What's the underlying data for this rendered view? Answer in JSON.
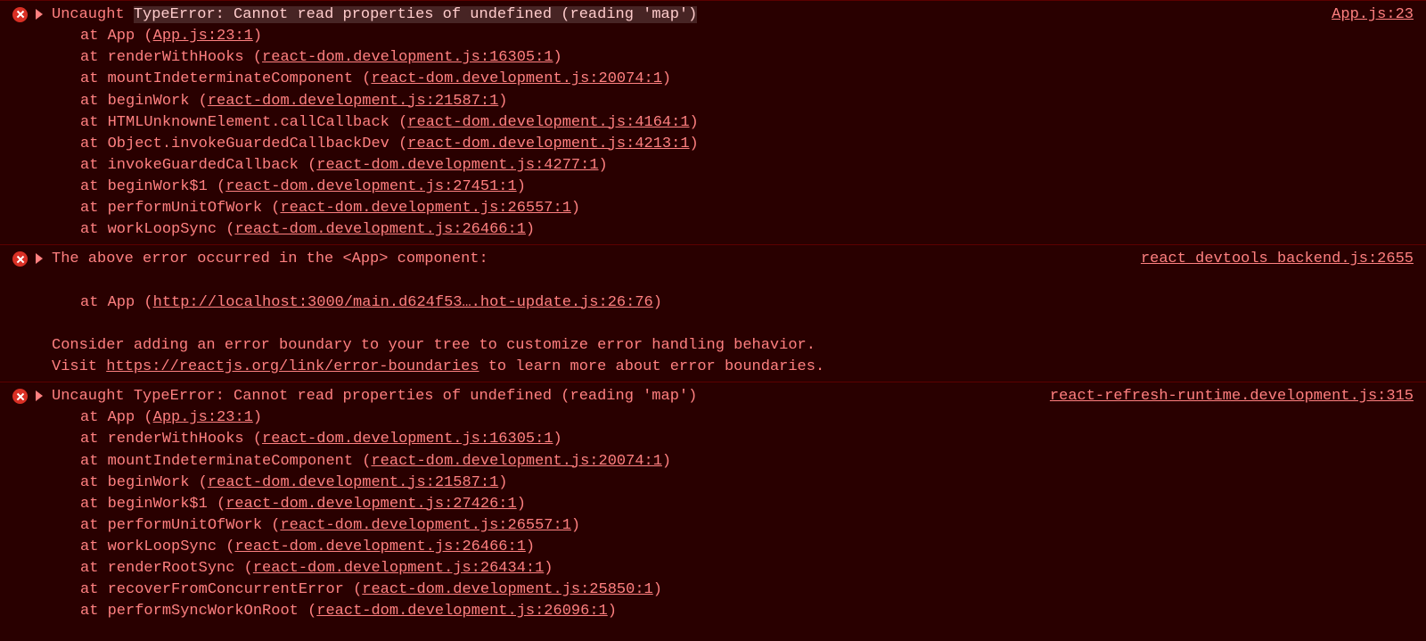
{
  "entries": [
    {
      "prefix": "Uncaught ",
      "highlighted": "TypeError: Cannot read properties of undefined (reading 'map')",
      "sourceLink": "App.js:23",
      "stack": [
        {
          "fn": "App",
          "src": "App.js:23:1"
        },
        {
          "fn": "renderWithHooks",
          "src": "react-dom.development.js:16305:1"
        },
        {
          "fn": "mountIndeterminateComponent",
          "src": "react-dom.development.js:20074:1"
        },
        {
          "fn": "beginWork",
          "src": "react-dom.development.js:21587:1"
        },
        {
          "fn": "HTMLUnknownElement.callCallback",
          "src": "react-dom.development.js:4164:1"
        },
        {
          "fn": "Object.invokeGuardedCallbackDev",
          "src": "react-dom.development.js:4213:1"
        },
        {
          "fn": "invokeGuardedCallback",
          "src": "react-dom.development.js:4277:1"
        },
        {
          "fn": "beginWork$1",
          "src": "react-dom.development.js:27451:1"
        },
        {
          "fn": "performUnitOfWork",
          "src": "react-dom.development.js:26557:1"
        },
        {
          "fn": "workLoopSync",
          "src": "react-dom.development.js:26466:1"
        }
      ]
    },
    {
      "headline": "The above error occurred in the <App> component:",
      "sourceLink": "react_devtools_backend.js:2655",
      "atLine": {
        "fn": "App",
        "src": "http://localhost:3000/main.d624f53….hot-update.js:26:76"
      },
      "advice1": "Consider adding an error boundary to your tree to customize error handling behavior.",
      "advice2a": "Visit ",
      "advice2link": "https://reactjs.org/link/error-boundaries",
      "advice2b": " to learn more about error boundaries."
    },
    {
      "headline": "Uncaught TypeError: Cannot read properties of undefined (reading 'map')",
      "sourceLink": "react-refresh-runtime.development.js:315",
      "stack": [
        {
          "fn": "App",
          "src": "App.js:23:1"
        },
        {
          "fn": "renderWithHooks",
          "src": "react-dom.development.js:16305:1"
        },
        {
          "fn": "mountIndeterminateComponent",
          "src": "react-dom.development.js:20074:1"
        },
        {
          "fn": "beginWork",
          "src": "react-dom.development.js:21587:1"
        },
        {
          "fn": "beginWork$1",
          "src": "react-dom.development.js:27426:1"
        },
        {
          "fn": "performUnitOfWork",
          "src": "react-dom.development.js:26557:1"
        },
        {
          "fn": "workLoopSync",
          "src": "react-dom.development.js:26466:1"
        },
        {
          "fn": "renderRootSync",
          "src": "react-dom.development.js:26434:1"
        },
        {
          "fn": "recoverFromConcurrentError",
          "src": "react-dom.development.js:25850:1"
        },
        {
          "fn": "performSyncWorkOnRoot",
          "src": "react-dom.development.js:26096:1"
        }
      ]
    }
  ]
}
